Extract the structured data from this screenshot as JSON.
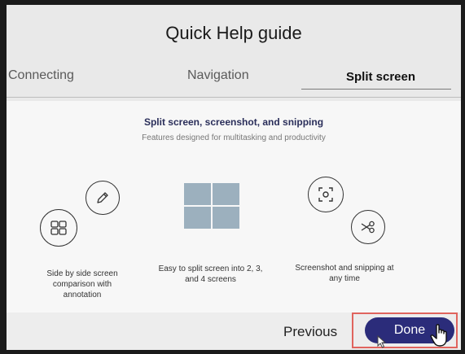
{
  "header": {
    "title": "Quick Help guide"
  },
  "tabs": [
    {
      "label": "Connecting"
    },
    {
      "label": "Navigation"
    },
    {
      "label": "Split screen"
    }
  ],
  "section": {
    "title": "Split screen, screenshot, and snipping",
    "subtitle": "Features designed for multitasking and productivity"
  },
  "features": {
    "side_by_side": "Side by side screen comparison with annotation",
    "split": "Easy to split screen into 2, 3, and 4 screens",
    "screenshot": "Screenshot and snipping at any time"
  },
  "icons": [
    "pencil-icon",
    "layout-grid-icon",
    "split-screen-grid-icon",
    "screenshot-icon",
    "scissors-icon"
  ],
  "footer": {
    "previous_label": "Previous",
    "done_label": "Done"
  },
  "colors": {
    "accent": "#2b2c7a",
    "highlight": "#e0645e",
    "title_text": "#2a2e5a"
  }
}
